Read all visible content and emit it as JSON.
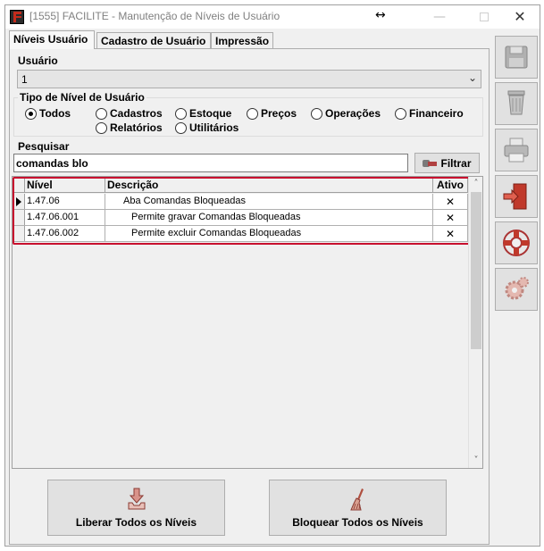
{
  "window": {
    "title": "[1555] FACILITE - Manutenção de Níveis de Usuário",
    "minimize_glyph": "—",
    "close_glyph": "✕",
    "resize_glyph": "↔"
  },
  "tabs": [
    {
      "label": "Níveis Usuário",
      "active": true
    },
    {
      "label": "Cadastro de Usuário",
      "active": false
    },
    {
      "label": "Impressão",
      "active": false
    }
  ],
  "usuario": {
    "label": "Usuário",
    "selected": "1",
    "chevron": "⌄"
  },
  "tipo_nivel": {
    "legend": "Tipo de Nível de Usuário",
    "options": [
      {
        "label": "Todos",
        "checked": true
      },
      {
        "label": "Cadastros",
        "checked": false
      },
      {
        "label": "Estoque",
        "checked": false
      },
      {
        "label": "Preços",
        "checked": false
      },
      {
        "label": "Operações",
        "checked": false
      },
      {
        "label": "Financeiro",
        "checked": false
      },
      {
        "label": "Relatórios",
        "checked": false
      },
      {
        "label": "Utilitários",
        "checked": false
      }
    ]
  },
  "pesquisar": {
    "label": "Pesquisar",
    "value": "comandas blo",
    "button_label": "Filtrar"
  },
  "grid": {
    "columns": [
      "Nível",
      "Descrição",
      "Ativo"
    ],
    "rows": [
      {
        "nivel": "1.47.06",
        "descricao": "Aba Comandas Bloqueadas",
        "ativo": "✕",
        "selected": true
      },
      {
        "nivel": "1.47.06.001",
        "descricao": "Permite gravar Comandas Bloqueadas",
        "ativo": "✕",
        "selected": false
      },
      {
        "nivel": "1.47.06.002",
        "descricao": "Permite excluir Comandas Bloqueadas",
        "ativo": "✕",
        "selected": false
      }
    ],
    "highlight_color": "#c8102e",
    "scroll_up_glyph": "˄",
    "scroll_down_glyph": "˅"
  },
  "actions": {
    "liberar_label": "Liberar Todos os Níveis",
    "bloquear_label": "Bloquear Todos os Níveis"
  },
  "toolbar_icons": [
    "save-icon",
    "trash-icon",
    "printer-icon",
    "exit-icon",
    "help-lifebuoy-icon",
    "settings-gear-icon"
  ]
}
